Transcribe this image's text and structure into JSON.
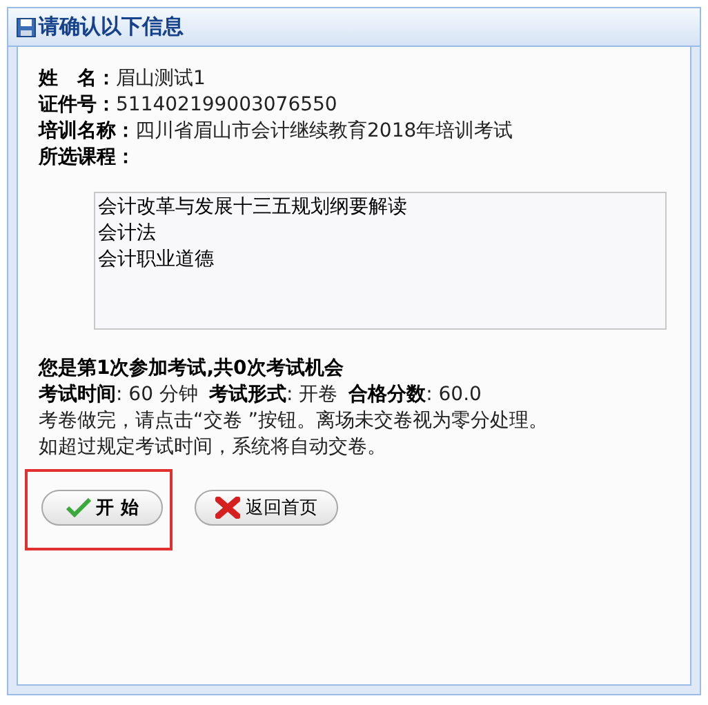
{
  "panel": {
    "title": "请确认以下信息"
  },
  "fields": [
    {
      "label": "姓　名：",
      "value": "眉山测试1"
    },
    {
      "label": "证件号：",
      "value": "511402199003076550"
    },
    {
      "label": "培训名称：",
      "value": "四川省眉山市会计继续教育2018年培训考试"
    },
    {
      "label": "所选课程："
    }
  ],
  "courses": [
    "会计改革与发展十三五规划纲要解读",
    "会计法",
    "会计职业道德"
  ],
  "attempt_notice": "您是第1次参加考试,共0次考试机会",
  "exam_info": [
    {
      "label": "考试时间",
      "value": ": 60 分钟"
    },
    {
      "label": "考试形式",
      "value": ": 开卷"
    },
    {
      "label": "合格分数",
      "value": ": 60.0"
    }
  ],
  "instructions": [
    "考卷做完，请点击“交卷 ”按钮。离场未交卷视为零分处理。",
    "如超过规定考试时间，系统将自动交卷。"
  ],
  "buttons": [
    {
      "kind": "start",
      "label": "开 始",
      "highlighted": true
    },
    {
      "kind": "back",
      "label": "返回首页",
      "highlighted": false
    }
  ]
}
